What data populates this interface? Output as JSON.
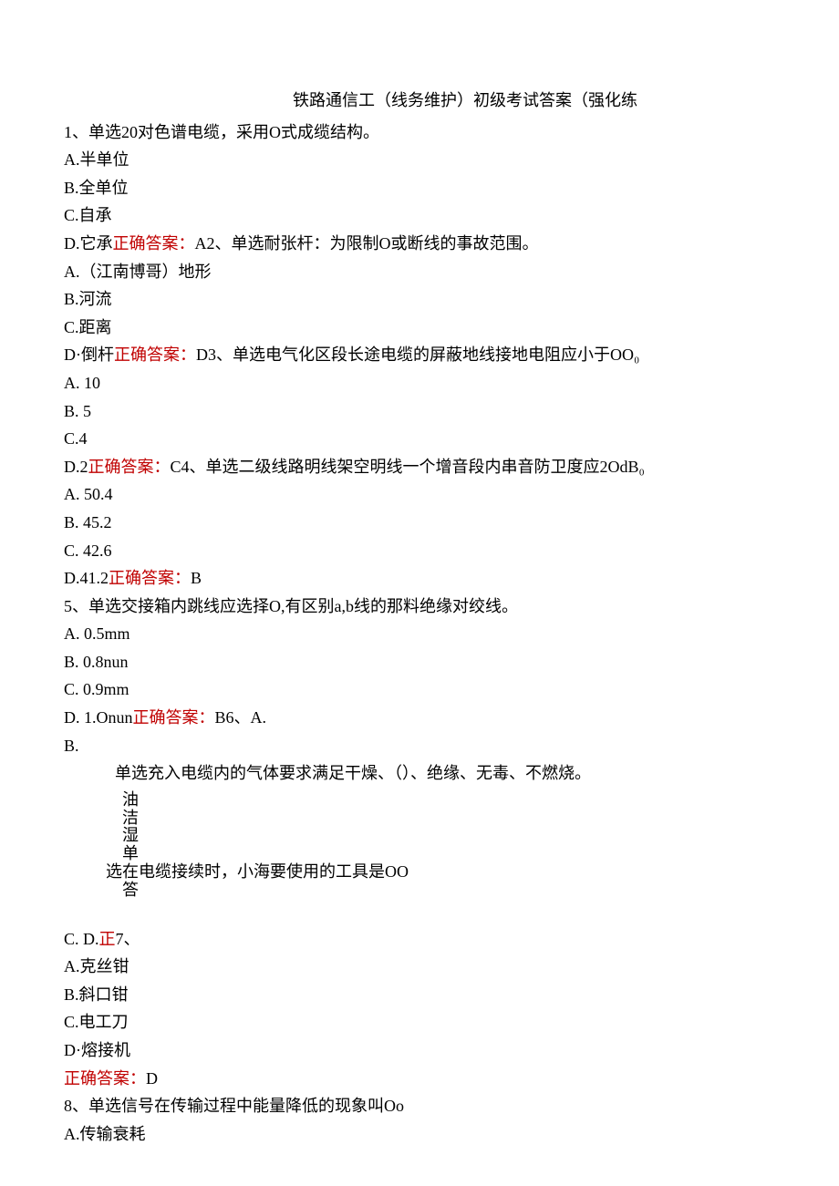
{
  "title": "铁路通信工（线务维护）初级考试答案（强化练",
  "q1": {
    "stem": "1、单选20对色谱电缆，采用O式成缆结构。",
    "a": "A.半单位",
    "b": "B.全单位",
    "c": "C.自承",
    "d_prefix": "D.它承",
    "d_answer": "正确答案：",
    "d_suffix": "A"
  },
  "q2": {
    "stem": "2、单选耐张杆：为限制O或断线的事故范围。",
    "a": "A.（江南博哥）地形",
    "b": "B.河流",
    "c": "C.距离",
    "d_prefix": "D·倒杆",
    "d_answer": "正确答案：",
    "d_suffix": "D"
  },
  "q3": {
    "stem": "3、单选电气化区段长途电缆的屏蔽地线接地电阻应小于OO₀",
    "a": "A.   10",
    "b": "B.   5",
    "c": "C.4",
    "d_prefix": "D.2",
    "d_answer": "正确答案：",
    "d_suffix": "C"
  },
  "q4": {
    "stem": "4、单选二级线路明线架空明线一个增音段内串音防卫度应2OdB₀",
    "a": "A.   50.4",
    "b": "B.   45.2",
    "c": "C.   42.6",
    "d_prefix": "D.41.2",
    "d_answer": "正确答案：",
    "d_suffix": "B"
  },
  "q5": {
    "stem": "5、单选交接箱内跳线应选择O,有区别a,b线的那料绝缘对绞线。",
    "a": "A.   0.5mm",
    "b": "B.   0.8nun",
    "c": "C.   0.9mm",
    "d_prefix": "D.   1.Onun",
    "d_answer": "正确答案：",
    "d_suffix": "B"
  },
  "q6": {
    "tail": "6、A.",
    "b_alone": "B.",
    "stem": "单选充入电缆内的气体要求满足干燥、（）、绝缘、无毒、不燃烧。",
    "v1": "油",
    "v2": "洁",
    "v3": "湿",
    "v4_pre": "单",
    "v4_post": "选在电缆接续时，小海要使用的工具是OO",
    "v5": "答",
    "cd_line_c": "C.      D.",
    "cd_line_ans": "正",
    "cd_line_tail": "7、"
  },
  "q7": {
    "a": "A.克丝钳",
    "b": "B.斜口钳",
    "c": "C.电工刀",
    "d": "D·熔接机",
    "ans": "正确答案：",
    "ans_val": "D"
  },
  "q8": {
    "stem": "8、单选信号在传输过程中能量降低的现象叫Oo",
    "a": "A.传输衰耗"
  }
}
